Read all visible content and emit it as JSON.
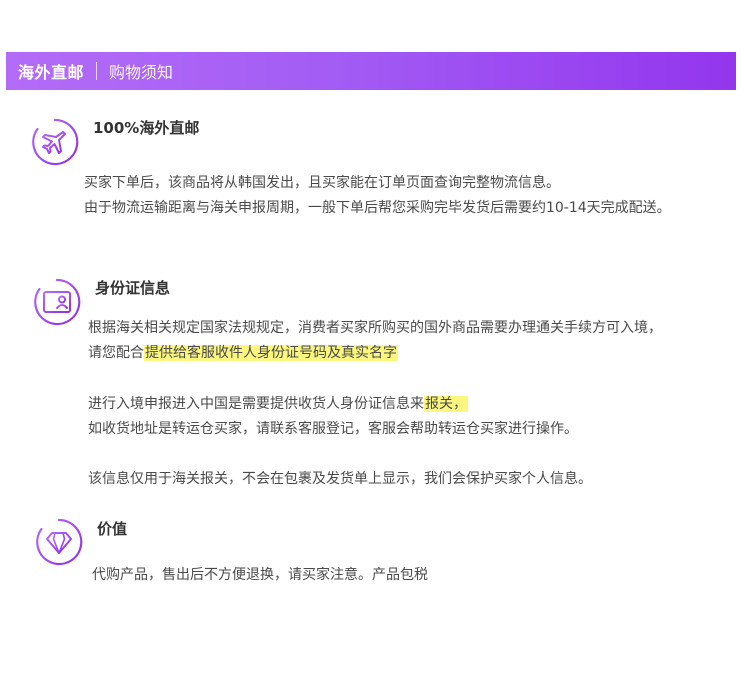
{
  "header": {
    "title": "海外直邮",
    "subtitle": "购物须知"
  },
  "sections": [
    {
      "icon": "airplane-icon",
      "title": "100%海外直邮",
      "lines": [
        "买家下单后，该商品将从韩国发出，且买家能在订单页面查询完整物流信息。",
        "由于物流运输距离与海关申报周期，一般下单后帮您采购完毕发货后需要约10-14天完成配送。"
      ]
    },
    {
      "icon": "id-card-icon",
      "title": "身份证信息",
      "p1_line1": "根据海关相关规定国家法规规定，消费者买家所购买的国外商品需要办理通关手续方可入境，",
      "p1_line2_prefix": "请您配合",
      "p1_line2_highlight": "提供给客服收件人身份证号码及真实名字",
      "p2_line1_prefix": "进行入境申报进入中国是需要提供收货人身份证信息来",
      "p2_line1_highlight": "报关，",
      "p2_line2": "如收货地址是转运仓买家，请联系客服登记，客服会帮助转运仓买家进行操作。",
      "p3_line1": "该信息仅用于海关报关，不会在包裹及发货单上显示，我们会保护买家个人信息。"
    },
    {
      "icon": "diamond-icon",
      "title": "价值",
      "line": "代购产品，售出后不方便退换，请买家注意。产品包税"
    }
  ],
  "colors": {
    "accent": "#9b4ef2",
    "highlight": "#fbf77e"
  }
}
